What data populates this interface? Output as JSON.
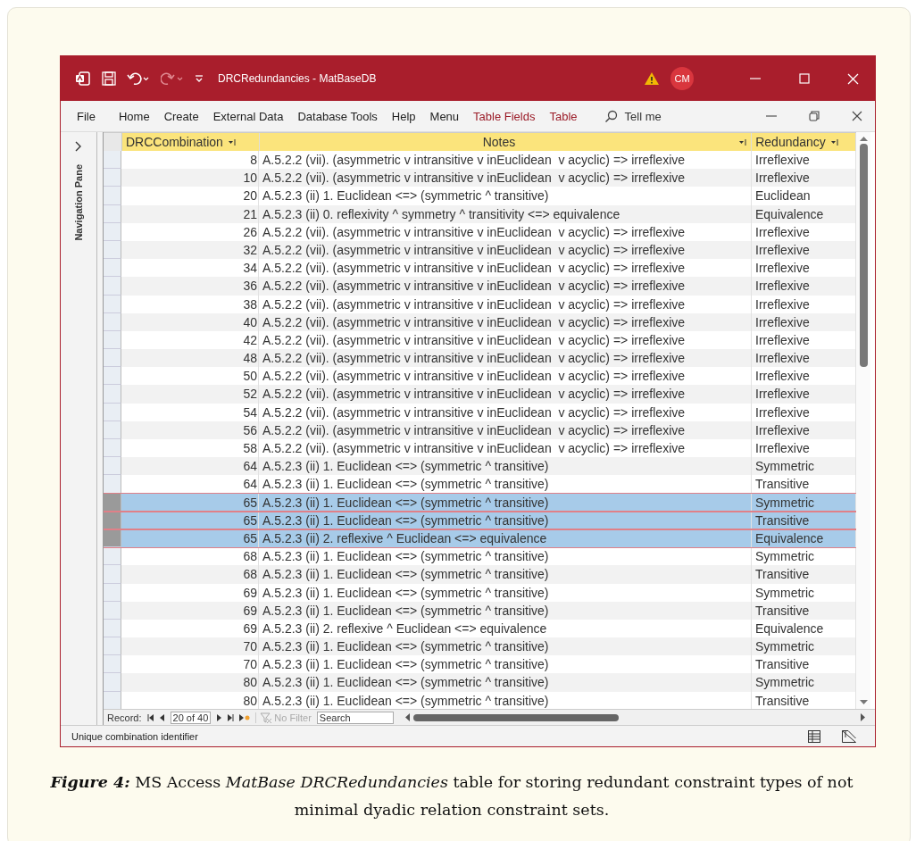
{
  "window": {
    "title": "DRCRedundancies  -  MatBaseDB",
    "user_initials": "CM"
  },
  "ribbon_tabs": [
    {
      "label": "File",
      "kind": "normal"
    },
    {
      "label": "Home",
      "kind": "normal"
    },
    {
      "label": "Create",
      "kind": "normal"
    },
    {
      "label": "External Data",
      "kind": "normal"
    },
    {
      "label": "Database Tools",
      "kind": "normal"
    },
    {
      "label": "Help",
      "kind": "normal"
    },
    {
      "label": "Menu",
      "kind": "normal"
    },
    {
      "label": "Table Fields",
      "kind": "contextual"
    },
    {
      "label": "Table",
      "kind": "contextual"
    }
  ],
  "tell_me": "Tell me",
  "navigation_pane": {
    "label": "Navigation Pane"
  },
  "table": {
    "columns": [
      "DRCCombination",
      "Notes",
      "Redundancy"
    ],
    "rows": [
      {
        "id": "8",
        "notes": "A.5.2.2 (vii). (asymmetric v intransitive v inEuclidean  v acyclic) => irreflexive",
        "redundancy": "Irreflexive",
        "selected": false
      },
      {
        "id": "10",
        "notes": "A.5.2.2 (vii). (asymmetric v intransitive v inEuclidean  v acyclic) => irreflexive",
        "redundancy": "Irreflexive",
        "selected": false
      },
      {
        "id": "20",
        "notes": "A.5.2.3 (ii) 1. Euclidean <=> (symmetric ^ transitive)",
        "redundancy": "Euclidean",
        "selected": false
      },
      {
        "id": "21",
        "notes": "A.5.2.3 (ii) 0. reflexivity ^ symmetry ^ transitivity <=> equivalence",
        "redundancy": "Equivalence",
        "selected": false
      },
      {
        "id": "26",
        "notes": "A.5.2.2 (vii). (asymmetric v intransitive v inEuclidean  v acyclic) => irreflexive",
        "redundancy": "Irreflexive",
        "selected": false
      },
      {
        "id": "32",
        "notes": "A.5.2.2 (vii). (asymmetric v intransitive v inEuclidean  v acyclic) => irreflexive",
        "redundancy": "Irreflexive",
        "selected": false
      },
      {
        "id": "34",
        "notes": "A.5.2.2 (vii). (asymmetric v intransitive v inEuclidean  v acyclic) => irreflexive",
        "redundancy": "Irreflexive",
        "selected": false
      },
      {
        "id": "36",
        "notes": "A.5.2.2 (vii). (asymmetric v intransitive v inEuclidean  v acyclic) => irreflexive",
        "redundancy": "Irreflexive",
        "selected": false
      },
      {
        "id": "38",
        "notes": "A.5.2.2 (vii). (asymmetric v intransitive v inEuclidean  v acyclic) => irreflexive",
        "redundancy": "Irreflexive",
        "selected": false
      },
      {
        "id": "40",
        "notes": "A.5.2.2 (vii). (asymmetric v intransitive v inEuclidean  v acyclic) => irreflexive",
        "redundancy": "Irreflexive",
        "selected": false
      },
      {
        "id": "42",
        "notes": "A.5.2.2 (vii). (asymmetric v intransitive v inEuclidean  v acyclic) => irreflexive",
        "redundancy": "Irreflexive",
        "selected": false
      },
      {
        "id": "48",
        "notes": "A.5.2.2 (vii). (asymmetric v intransitive v inEuclidean  v acyclic) => irreflexive",
        "redundancy": "Irreflexive",
        "selected": false
      },
      {
        "id": "50",
        "notes": "A.5.2.2 (vii). (asymmetric v intransitive v inEuclidean  v acyclic) => irreflexive",
        "redundancy": "Irreflexive",
        "selected": false
      },
      {
        "id": "52",
        "notes": "A.5.2.2 (vii). (asymmetric v intransitive v inEuclidean  v acyclic) => irreflexive",
        "redundancy": "Irreflexive",
        "selected": false
      },
      {
        "id": "54",
        "notes": "A.5.2.2 (vii). (asymmetric v intransitive v inEuclidean  v acyclic) => irreflexive",
        "redundancy": "Irreflexive",
        "selected": false
      },
      {
        "id": "56",
        "notes": "A.5.2.2 (vii). (asymmetric v intransitive v inEuclidean  v acyclic) => irreflexive",
        "redundancy": "Irreflexive",
        "selected": false
      },
      {
        "id": "58",
        "notes": "A.5.2.2 (vii). (asymmetric v intransitive v inEuclidean  v acyclic) => irreflexive",
        "redundancy": "Irreflexive",
        "selected": false
      },
      {
        "id": "64",
        "notes": "A.5.2.3 (ii) 1. Euclidean <=> (symmetric ^ transitive)",
        "redundancy": "Symmetric",
        "selected": false
      },
      {
        "id": "64",
        "notes": "A.5.2.3 (ii) 1. Euclidean <=> (symmetric ^ transitive)",
        "redundancy": "Transitive",
        "selected": false
      },
      {
        "id": "65",
        "notes": "A.5.2.3 (ii) 1. Euclidean <=> (symmetric ^ transitive)",
        "redundancy": "Symmetric",
        "selected": true
      },
      {
        "id": "65",
        "notes": "A.5.2.3 (ii) 1. Euclidean <=> (symmetric ^ transitive)",
        "redundancy": "Transitive",
        "selected": true
      },
      {
        "id": "65",
        "notes": "A.5.2.3 (ii) 2. reflexive ^ Euclidean <=> equivalence",
        "redundancy": "Equivalence",
        "selected": true
      },
      {
        "id": "68",
        "notes": "A.5.2.3 (ii) 1. Euclidean <=> (symmetric ^ transitive)",
        "redundancy": "Symmetric",
        "selected": false
      },
      {
        "id": "68",
        "notes": "A.5.2.3 (ii) 1. Euclidean <=> (symmetric ^ transitive)",
        "redundancy": "Transitive",
        "selected": false
      },
      {
        "id": "69",
        "notes": "A.5.2.3 (ii) 1. Euclidean <=> (symmetric ^ transitive)",
        "redundancy": "Symmetric",
        "selected": false
      },
      {
        "id": "69",
        "notes": "A.5.2.3 (ii) 1. Euclidean <=> (symmetric ^ transitive)",
        "redundancy": "Transitive",
        "selected": false
      },
      {
        "id": "69",
        "notes": "A.5.2.3 (ii) 2. reflexive ^ Euclidean <=> equivalence",
        "redundancy": "Equivalence",
        "selected": false
      },
      {
        "id": "70",
        "notes": "A.5.2.3 (ii) 1. Euclidean <=> (symmetric ^ transitive)",
        "redundancy": "Symmetric",
        "selected": false
      },
      {
        "id": "70",
        "notes": "A.5.2.3 (ii) 1. Euclidean <=> (symmetric ^ transitive)",
        "redundancy": "Transitive",
        "selected": false
      },
      {
        "id": "80",
        "notes": "A.5.2.3 (ii) 1. Euclidean <=> (symmetric ^ transitive)",
        "redundancy": "Symmetric",
        "selected": false
      },
      {
        "id": "80",
        "notes": "A.5.2.3 (ii) 1. Euclidean <=> (symmetric ^ transitive)",
        "redundancy": "Transitive",
        "selected": false
      }
    ]
  },
  "record_bar": {
    "label": "Record:",
    "position": "20 of 40",
    "filter": "No Filter",
    "search": "Search"
  },
  "status_bar": "Unique combination identifier",
  "caption": "**Figure 4:** MS Access *MatBase DRCRedundancies* table for storing redundant constraint types of not minimal dyadic relation constraint sets."
}
